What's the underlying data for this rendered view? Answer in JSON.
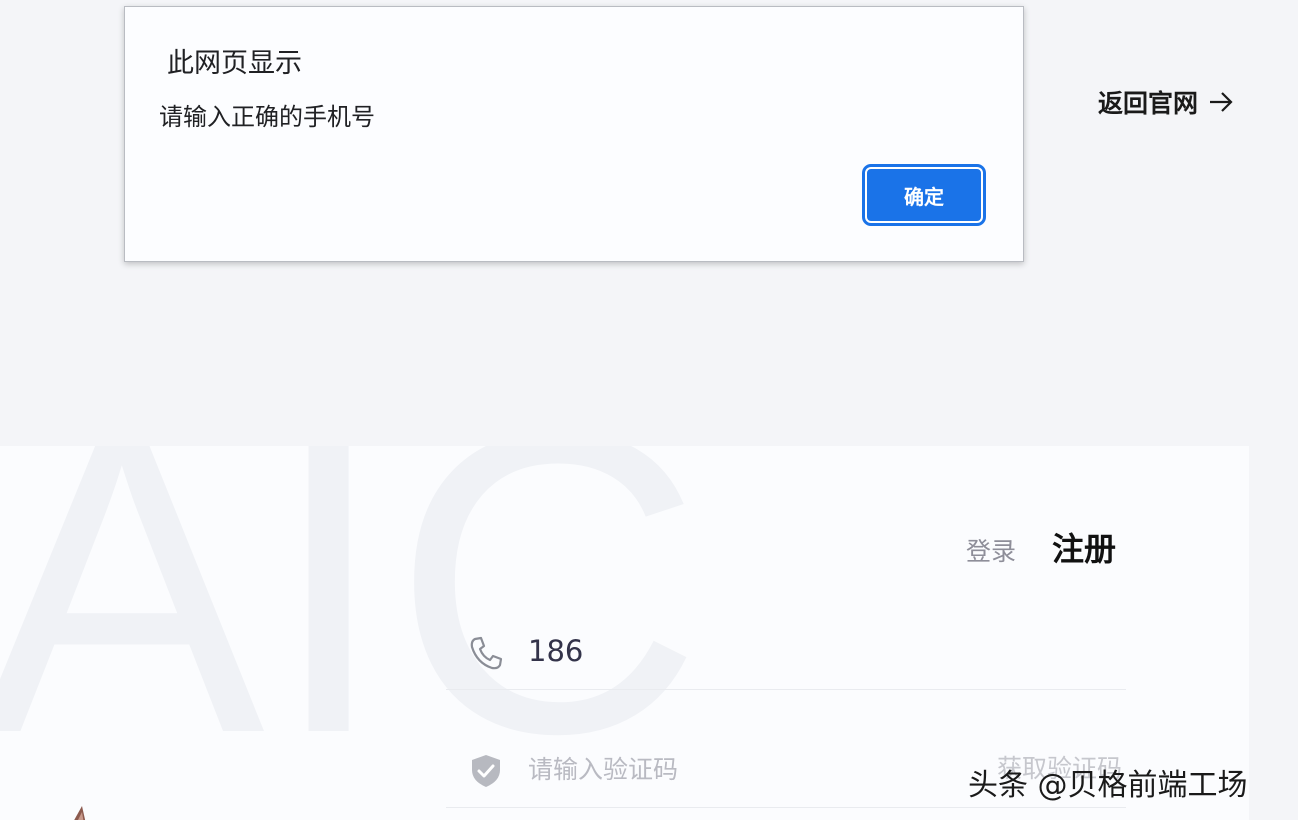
{
  "header": {
    "back_link_label": "返回官网",
    "back_link_icon": "arrow-right-icon"
  },
  "card": {
    "watermark_text": "AIC",
    "tabs": {
      "login_label": "登录",
      "register_label": "注册"
    },
    "phone_field": {
      "icon": "phone-icon",
      "value": "186"
    },
    "code_field": {
      "icon": "shield-check-icon",
      "placeholder": "请输入验证码",
      "get_code_label": "获取验证码"
    }
  },
  "dialog": {
    "title": "此网页显示",
    "message": "请输入正确的手机号",
    "ok_label": "确定",
    "accent_color": "#1a73e8"
  },
  "credit": {
    "text": "头条 @贝格前端工场"
  }
}
